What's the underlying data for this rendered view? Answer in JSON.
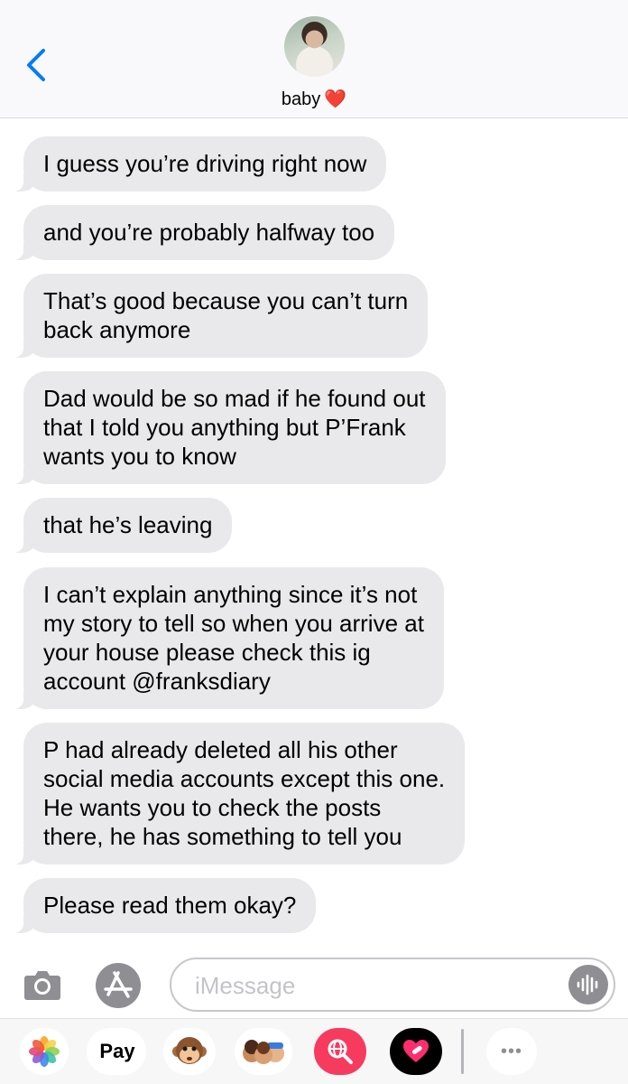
{
  "header": {
    "contact_name": "baby",
    "heart": "❤️"
  },
  "messages": [
    {
      "text": "I guess you’re driving right now"
    },
    {
      "text": "and you’re probably halfway too"
    },
    {
      "text": "That’s good because you can’t turn\nback anymore"
    },
    {
      "text": "Dad would be so mad if he found out\nthat I told you anything but P’Frank\nwants you to know"
    },
    {
      "text": "that he’s leaving"
    },
    {
      "text": "I can’t explain anything since it’s not\nmy story to tell so when you arrive at\nyour house please check this ig\naccount @franksdiary"
    },
    {
      "text": "P had already deleted all his other\nsocial media accounts except this one.\nHe wants you to check the posts\nthere, he has something to tell you"
    },
    {
      "text": "Please read them okay?"
    }
  ],
  "input": {
    "placeholder": "iMessage",
    "value": ""
  },
  "drawer": {
    "pay_label": "Pay",
    "apple_glyph": "",
    "more_label": "•••"
  },
  "colors": {
    "accent": "#007aff",
    "bubble_received": "#e9e9eb",
    "heart": "#e0242d",
    "search_app": "#f73b5f"
  }
}
